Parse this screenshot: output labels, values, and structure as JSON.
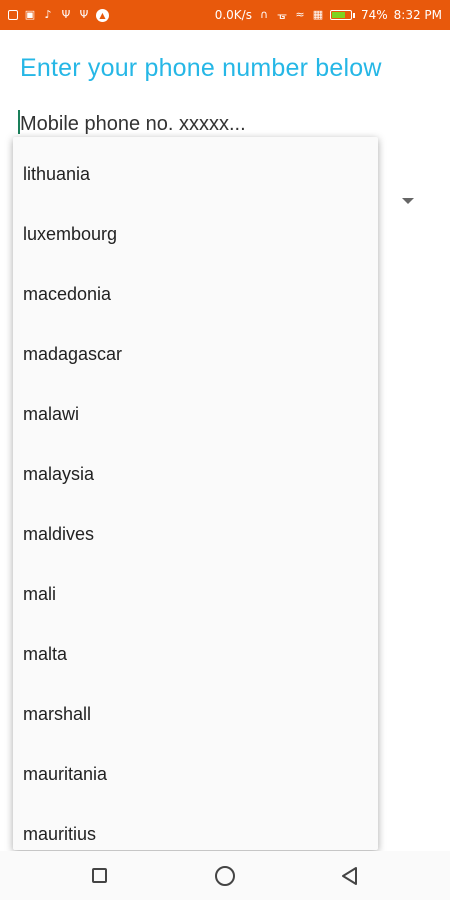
{
  "status_bar": {
    "network_speed": "0.0K/s",
    "battery_percent": "74%",
    "battery_level": 0.74,
    "time": "8:32 PM",
    "left_icons": [
      "mail-icon",
      "notification-icon",
      "volume-icon",
      "usb-icon",
      "usb-debug-icon",
      "app-badge-icon"
    ],
    "right_icons": [
      "headset-icon",
      "bluetooth-icon",
      "wifi-icon",
      "signal-icon"
    ],
    "colors": {
      "background": "#e8590c",
      "battery_fill": "#7ed321"
    }
  },
  "heading": "Enter your phone number below",
  "phone_input": {
    "placeholder": "Mobile phone no. xxxxx...",
    "value": ""
  },
  "country_dropdown": {
    "items": [
      "lithuania",
      "luxembourg",
      "macedonia",
      "madagascar",
      "malawi",
      "malaysia",
      "maldives",
      "mali",
      "malta",
      "marshall",
      "mauritania",
      "mauritius"
    ]
  },
  "nav_bar": {
    "buttons": [
      "recent-apps-icon",
      "home-icon",
      "back-icon"
    ]
  },
  "colors": {
    "accent": "#26b7e6"
  }
}
